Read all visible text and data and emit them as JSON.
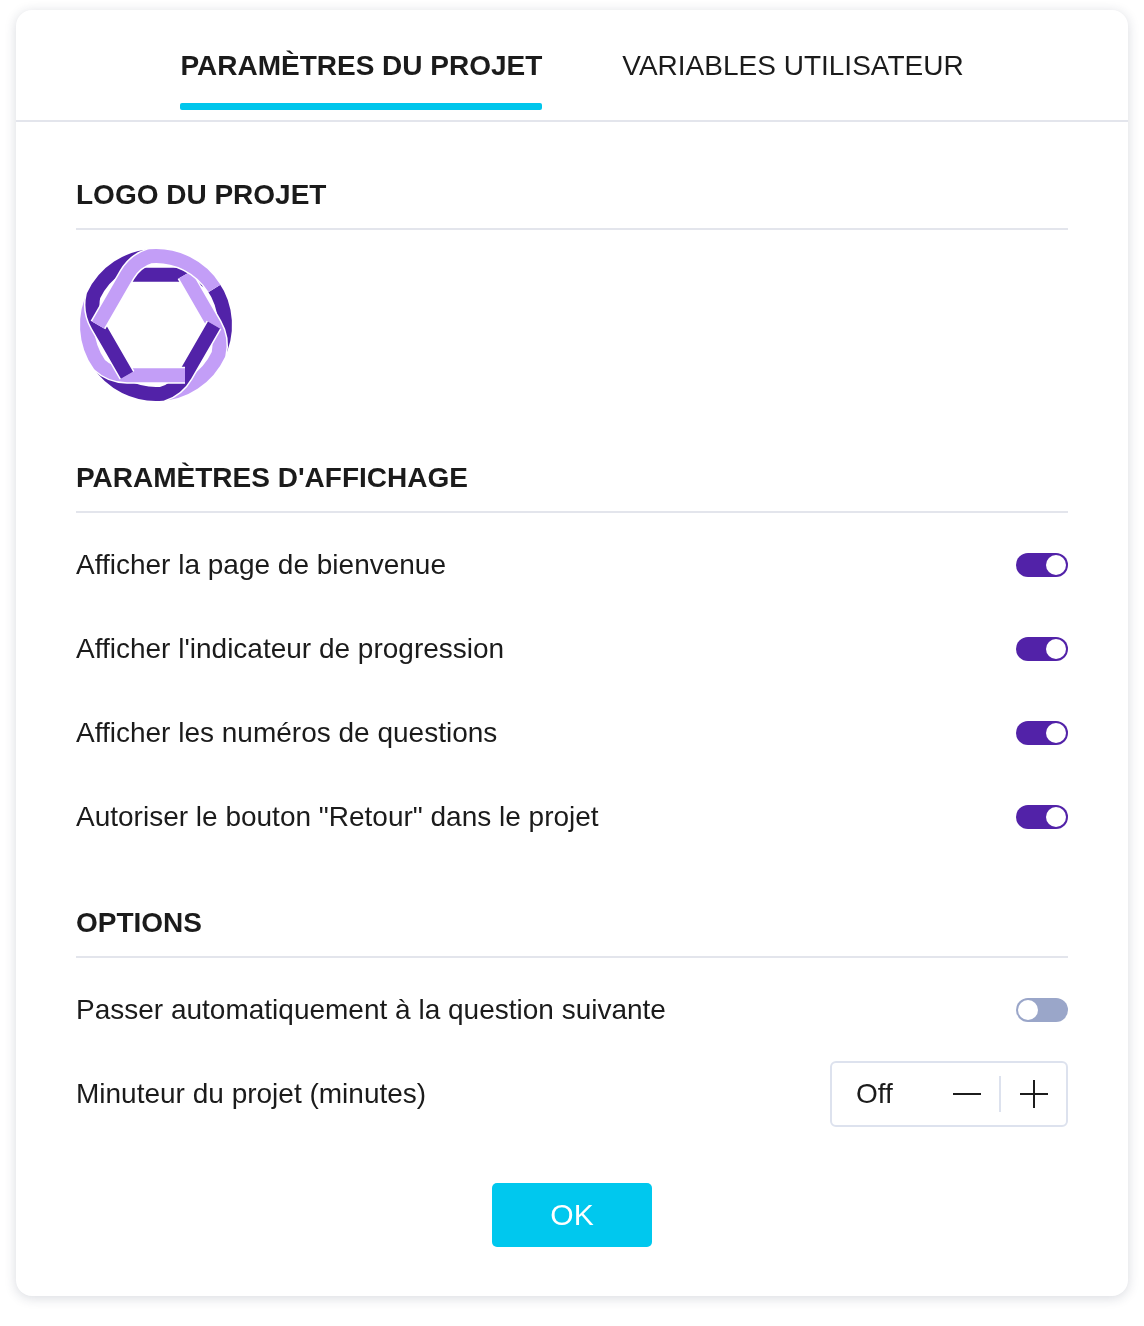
{
  "tabs": [
    {
      "label": "PARAMÈTRES DU PROJET",
      "selected": true
    },
    {
      "label": "VARIABLES UTILISATEUR",
      "selected": false
    }
  ],
  "sections": [
    {
      "title": "LOGO DU PROJET",
      "kind": "logo"
    },
    {
      "title": "PARAMÈTRES D'AFFICHAGE",
      "kind": "settings",
      "rows": [
        {
          "label": "Afficher la page de bienvenue",
          "kind": "toggle",
          "on": true
        },
        {
          "label": "Afficher l'indicateur de progression",
          "kind": "toggle",
          "on": true
        },
        {
          "label": "Afficher les numéros de questions",
          "kind": "toggle",
          "on": true
        },
        {
          "label": "Autoriser le bouton \"Retour\" dans le projet",
          "kind": "toggle",
          "on": true
        }
      ]
    },
    {
      "title": "OPTIONS",
      "kind": "settings",
      "rows": [
        {
          "label": "Passer automatiquement à la question suivante",
          "kind": "toggle",
          "on": false
        },
        {
          "label": "Minuteur du projet (minutes)",
          "kind": "stepper",
          "value": "Off"
        }
      ]
    }
  ],
  "buttons": [
    {
      "label": "OK"
    }
  ]
}
